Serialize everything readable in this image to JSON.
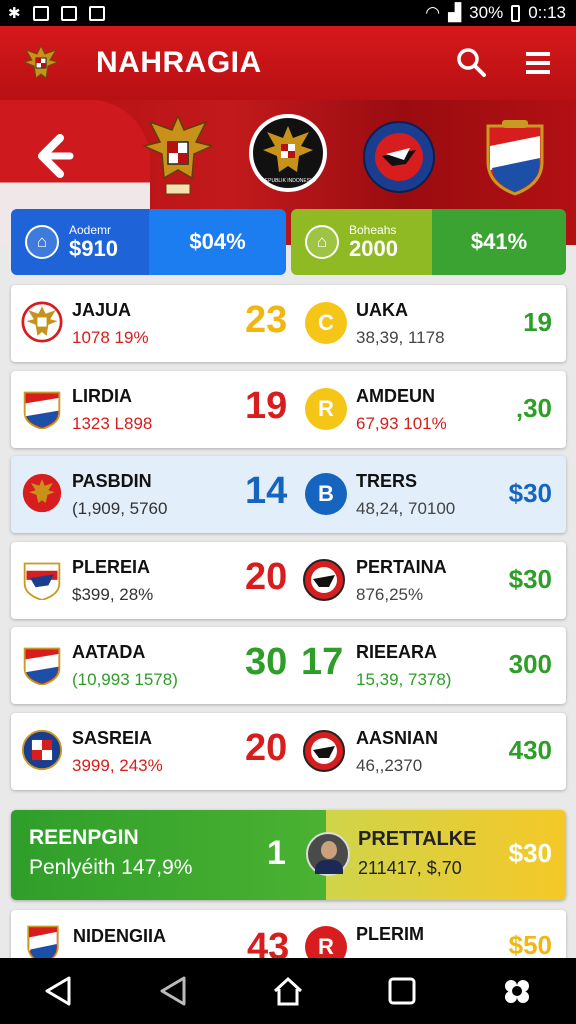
{
  "status_bar": {
    "battery": "30%",
    "time": "0::13"
  },
  "app_bar": {
    "title": "NAHRAGIA",
    "logo_icon": "garuda-crest-icon",
    "search_icon": "search-icon",
    "menu_icon": "hamburger-menu-icon"
  },
  "banner": {
    "back_icon": "back-arrow-icon",
    "crest_badge_text": "REPUBLIK INDONESIA"
  },
  "stats": [
    {
      "label": "Aodemr",
      "value": "$910",
      "right": "$04%",
      "color_left": "#1e63d8",
      "color_right": "#1c7df0",
      "icon": "bank-icon"
    },
    {
      "label": "Boheahs",
      "value": "2000",
      "right": "$41%",
      "color_left": "#8fba24",
      "color_right": "#3aa331",
      "icon": "bank-icon"
    }
  ],
  "rows": [
    {
      "name": "JAJUA",
      "sub": "1078 19%",
      "sub_color": "#d71d1d",
      "score": "23",
      "score_color": "#f1b710",
      "badge": "C",
      "badge_bg": "#f5c518",
      "badge_fg": "#fff",
      "name2": "UAKA",
      "sub2": "38,39, 1178",
      "sub2_color": "#444",
      "value": "19",
      "value_color": "#2e9e28"
    },
    {
      "name": "LIRDIA",
      "sub": "1323 L898",
      "sub_color": "#d71d1d",
      "score": "19",
      "score_color": "#d71d1d",
      "badge": "R",
      "badge_bg": "#f5c518",
      "badge_fg": "#fff",
      "name2": "AMDEUN",
      "sub2": "67,93 101%",
      "sub2_color": "#d71d1d",
      "value": "‚30",
      "value_color": "#2e9e28"
    },
    {
      "name": "PASBDIN",
      "sub": "(1,909, 5760",
      "sub_color": "#333",
      "score": "14",
      "score_color": "#1565c0",
      "badge": "B",
      "badge_bg": "#1565c0",
      "badge_fg": "#fff",
      "name2": "TRERS",
      "sub2": "48,24, 70100",
      "sub2_color": "#444",
      "value": "$30",
      "value_color": "#1565c0"
    },
    {
      "name": "PLEREIA",
      "sub": "$399, 28%",
      "sub_color": "#333",
      "score": "20",
      "score_color": "#d71d1d",
      "badge": "",
      "badge_bg": "",
      "badge_fg": "",
      "name2": "PERTAINA",
      "sub2": "876,25%",
      "sub2_color": "#444",
      "value": "$30",
      "value_color": "#2e9e28"
    },
    {
      "name": "AATADA",
      "sub": "(10,993 1578)",
      "sub_color": "#2e9e28",
      "score": "30",
      "score_color": "#2e9e28",
      "badge": "17",
      "badge_bg": "",
      "badge_fg": "#2e9e28",
      "name2": "RIEEARA",
      "sub2": "15,39, 7378)",
      "sub2_color": "#2e9e28",
      "value": "300",
      "value_color": "#2e9e28"
    },
    {
      "name": "SASREIA",
      "sub": "3999, 243%",
      "sub_color": "#d71d1d",
      "score": "20",
      "score_color": "#d71d1d",
      "badge": "",
      "badge_bg": "",
      "badge_fg": "",
      "name2": "AASNIAN",
      "sub2": "46,,2370",
      "sub2_color": "#444",
      "value": "430",
      "value_color": "#2e9e28"
    }
  ],
  "feature": {
    "name": "REENPGIN",
    "sub": "Penlyéith 147,9%",
    "score": "1",
    "name2": "PRETTALKE",
    "sub2": "211417, $,70",
    "value": "$30"
  },
  "last_row": {
    "name": "NIDENGIIA",
    "score": "43",
    "badge": "R",
    "name2": "PLERIM",
    "value": "$50"
  },
  "nav_bar": {
    "back_icon": "nav-back-icon",
    "back2_icon": "nav-back-outline-icon",
    "home_icon": "nav-home-icon",
    "recent_icon": "nav-recent-icon",
    "assist_icon": "nav-assistant-icon"
  }
}
